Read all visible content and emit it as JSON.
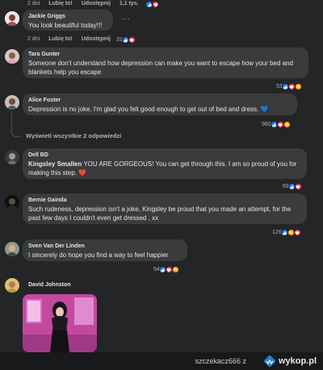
{
  "top_actions": {
    "time": "2 dni",
    "like": "Lubię to!",
    "reply": "Udostępnij",
    "count": "1,1 tys."
  },
  "comments": [
    {
      "author": "Jackie Griggs",
      "text": "You look beautiful today!!!",
      "time": "2 dni",
      "like": "Lubię to!",
      "reply": "Udostępnij",
      "reaction_count": "31",
      "more": "..."
    },
    {
      "author": "Tara Gunter",
      "text": "Someone don't understand how depression can make you want to escape how your bed and blankets help you escape",
      "reaction_count": "53"
    },
    {
      "author": "Alice Foster",
      "text": "Depression is no joke. I'm glad you felt good enough to get out of bed and dress. 💙",
      "reaction_count": "960"
    },
    {
      "author": "Dell BD",
      "mention": "Kingsley Smallen",
      "text": " YOU ARE GORGEOUS! You can get through this. I am so proud of you for making this step. ❤️",
      "reaction_count": "69"
    },
    {
      "author": "Bernie Gainda",
      "text": "Such rudeness, depression isn't a joke, Kingsley be proud that you made an attempt, for the past few days I couldn't even get dressed , xx",
      "reaction_count": "126"
    },
    {
      "author": "Sven Van Der Linden",
      "text": "I sincerely do hope you find a way to feel happier",
      "reaction_count": "54"
    },
    {
      "author": "David Johnston"
    }
  ],
  "view_replies": "Wyświetl wszystkie 2 odpowiedzi",
  "watermark": {
    "user": "szczekacz666",
    "separator": "z",
    "site": "wykop.pl"
  },
  "colors": {
    "background": "#242526",
    "bubble": "#3a3b3c",
    "like": "#1877f2",
    "love": "#f33e58",
    "care": "#f7b125"
  }
}
